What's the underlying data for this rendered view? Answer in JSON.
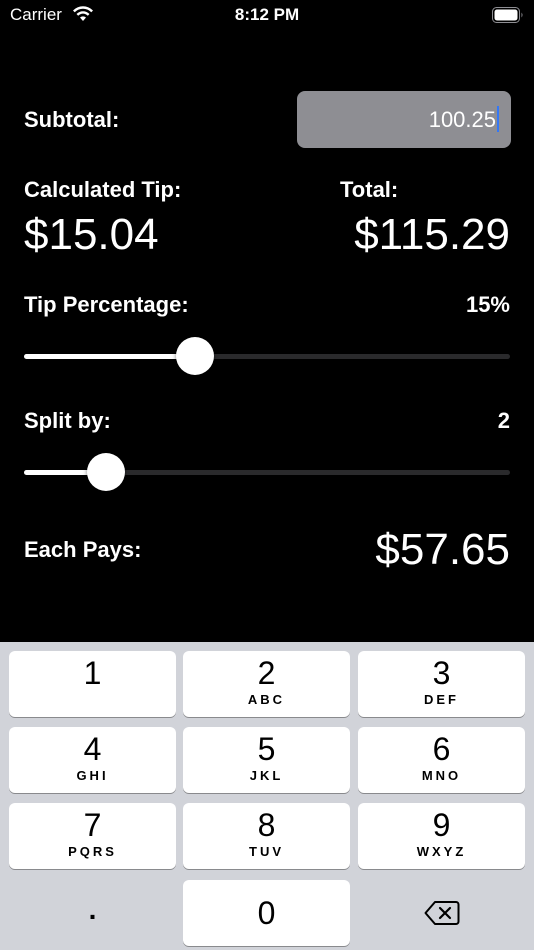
{
  "status_bar": {
    "carrier": "Carrier",
    "time": "8:12 PM"
  },
  "main": {
    "subtotal_label": "Subtotal:",
    "subtotal_value": "100.25",
    "calculated_tip_label": "Calculated Tip:",
    "calculated_tip_value": "$15.04",
    "total_label": "Total:",
    "total_value": "$115.29",
    "tip_percentage_label": "Tip Percentage:",
    "tip_percentage_value": "15%",
    "tip_slider_fraction": 0.34,
    "split_label": "Split by:",
    "split_value": "2",
    "split_slider_fraction": 0.14,
    "each_pays_label": "Each Pays:",
    "each_pays_value": "$57.65"
  },
  "keyboard": {
    "keys": [
      {
        "digit": "1",
        "letters": ""
      },
      {
        "digit": "2",
        "letters": "ABC"
      },
      {
        "digit": "3",
        "letters": "DEF"
      },
      {
        "digit": "4",
        "letters": "GHI"
      },
      {
        "digit": "5",
        "letters": "JKL"
      },
      {
        "digit": "6",
        "letters": "MNO"
      },
      {
        "digit": "7",
        "letters": "PQRS"
      },
      {
        "digit": "8",
        "letters": "TUV"
      },
      {
        "digit": "9",
        "letters": "WXYZ"
      },
      {
        "digit": "0",
        "letters": ""
      }
    ],
    "decimal_label": ".",
    "delete_icon": "delete-backspace-icon"
  },
  "colors": {
    "background": "#000000",
    "field": "#8e8e93",
    "caret": "#3478f6",
    "keyboard_bg": "#d1d3d9"
  }
}
